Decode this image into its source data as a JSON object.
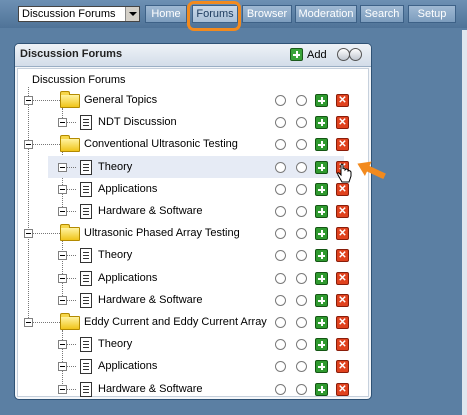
{
  "toolbar": {
    "selector": {
      "value": "Discussion Forums"
    },
    "nav": [
      {
        "id": "home",
        "label": "Home"
      },
      {
        "id": "forums",
        "label": "Forums",
        "active": true
      },
      {
        "id": "browser",
        "label": "Browser"
      },
      {
        "id": "moderation",
        "label": "Moderation"
      },
      {
        "id": "search",
        "label": "Search"
      },
      {
        "id": "setup",
        "label": "Setup"
      }
    ]
  },
  "panel": {
    "title": "Discussion Forums",
    "add_label": "Add",
    "root_label": "Discussion Forums",
    "groups": [
      {
        "label": "General Topics",
        "children": [
          {
            "label": "NDT Discussion"
          }
        ]
      },
      {
        "label": "Conventional Ultrasonic Testing",
        "children": [
          {
            "label": "Theory",
            "selected": true
          },
          {
            "label": "Applications"
          },
          {
            "label": "Hardware & Software"
          }
        ]
      },
      {
        "label": "Ultrasonic Phased Array Testing",
        "children": [
          {
            "label": "Theory"
          },
          {
            "label": "Applications"
          },
          {
            "label": "Hardware & Software"
          }
        ]
      },
      {
        "label": "Eddy Current and Eddy Current Array",
        "children": [
          {
            "label": "Theory"
          },
          {
            "label": "Applications"
          },
          {
            "label": "Hardware & Software"
          }
        ]
      }
    ],
    "row_actions": {
      "delete_glyph": "✕"
    }
  },
  "colors": {
    "background": "#5b7fa3",
    "highlight": "#f28a1e",
    "add_green": "#2f9a2f",
    "delete_red": "#e0421e",
    "selected_row": "#e6ebf5"
  },
  "icons": {
    "folder": "folder-icon",
    "document": "document-icon",
    "add": "add-icon",
    "delete": "delete-icon",
    "cursor": "hand-cursor-icon",
    "pointer": "pointer-arrow-icon"
  }
}
